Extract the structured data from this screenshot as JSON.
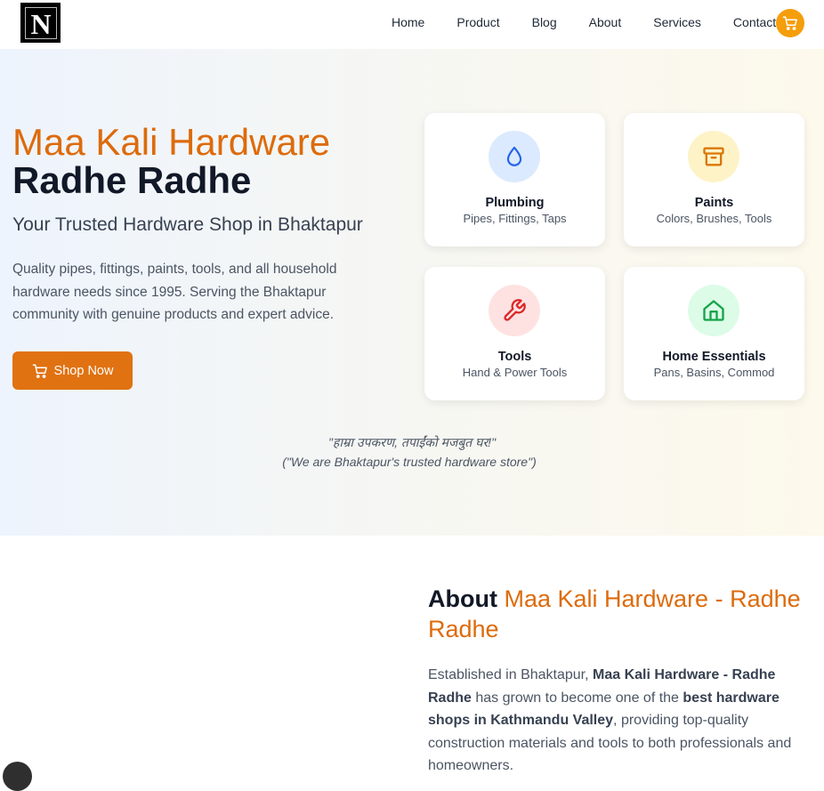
{
  "header": {
    "logo_letter": "N",
    "nav": [
      "Home",
      "Product",
      "Blog",
      "About",
      "Services",
      "Contact"
    ],
    "cart_icon": "cart-icon"
  },
  "hero": {
    "title_line1": "Maa Kali Hardware",
    "title_line2": "Radhe Radhe",
    "subtitle": "Your Trusted Hardware Shop in Bhaktapur",
    "description": "Quality pipes, fittings, paints, tools, and all household hardware needs since 1995. Serving the Bhaktapur community with genuine products and expert advice.",
    "cta_label": "Shop Now",
    "categories": [
      {
        "name": "Plumbing",
        "sub": "Pipes, Fittings, Taps",
        "icon": "droplet-icon",
        "bg": "#dbeafe",
        "color": "#2563eb"
      },
      {
        "name": "Paints",
        "sub": "Colors, Brushes, Tools",
        "icon": "archive-icon",
        "bg": "#fef3c7",
        "color": "#d97706"
      },
      {
        "name": "Tools",
        "sub": "Hand & Power Tools",
        "icon": "wrench-icon",
        "bg": "#fee2e2",
        "color": "#dc2626"
      },
      {
        "name": "Home Essentials",
        "sub": "Pans, Basins, Commod",
        "icon": "home-icon",
        "bg": "#dcfce7",
        "color": "#16a34a"
      }
    ],
    "quote_nepali": "\"हाम्रा उपकरण, तपाईंको मजबुत घर!\"",
    "quote_english": "(\"We are Bhaktapur's trusted hardware store\")"
  },
  "about": {
    "title_dark": "About",
    "title_orange": "Maa Kali Hardware - Radhe Radhe",
    "p1": "Established in Bhaktapur, ",
    "p1_bold": "Maa Kali Hardware - Radhe Radhe",
    "p2": " has grown to become one of the ",
    "p2_bold": "best hardware shops in Kathmandu Valley",
    "p3": ", providing top-quality construction materials and tools to both professionals and homeowners."
  },
  "colors": {
    "accent": "#e07212",
    "cart": "#f59e0b",
    "title_orange": "#dd6b0c"
  }
}
